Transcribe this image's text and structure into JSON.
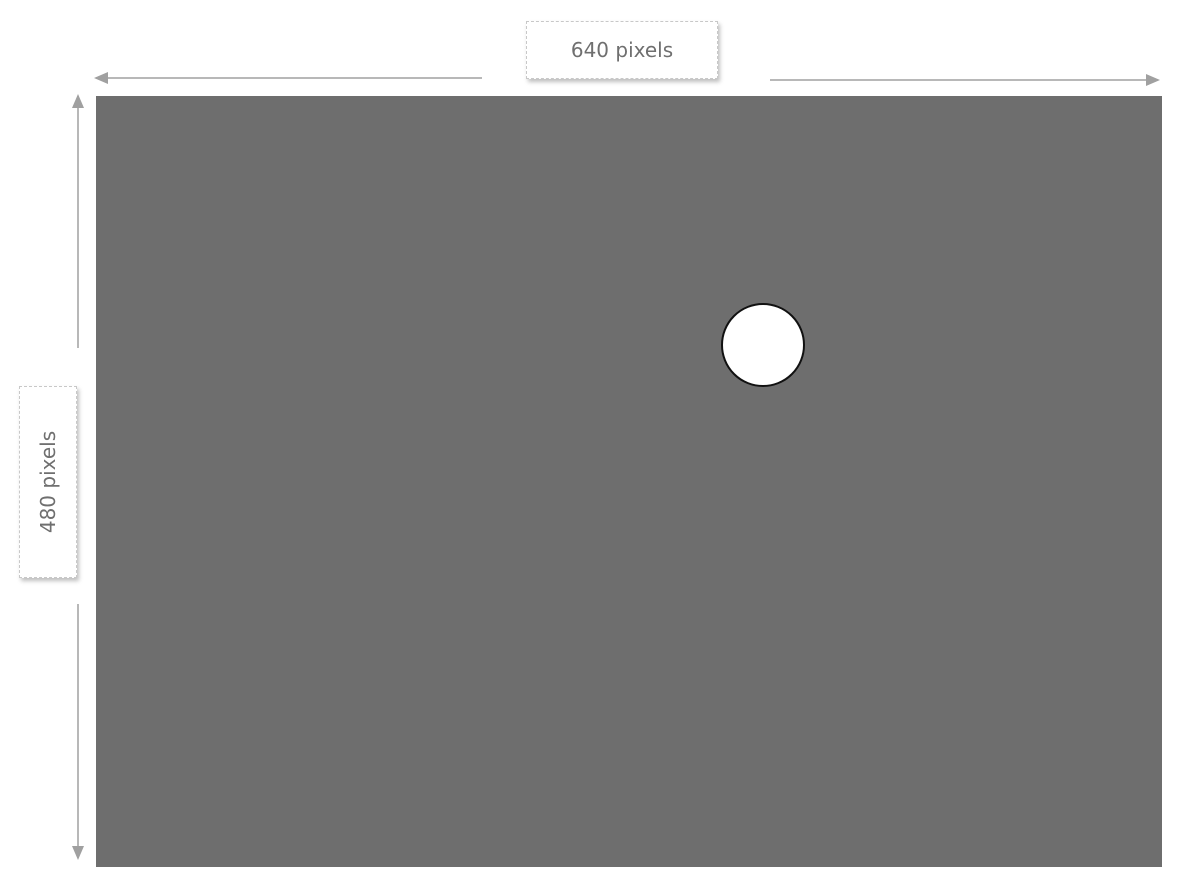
{
  "labels": {
    "width": "640 pixels",
    "height": "480 pixels"
  },
  "colors": {
    "canvas": "#6e6e6e",
    "arrow": "#a0a0a0",
    "dot_fill": "#ffffff",
    "dot_stroke": "#111111",
    "label_text": "#6f6f6f"
  }
}
